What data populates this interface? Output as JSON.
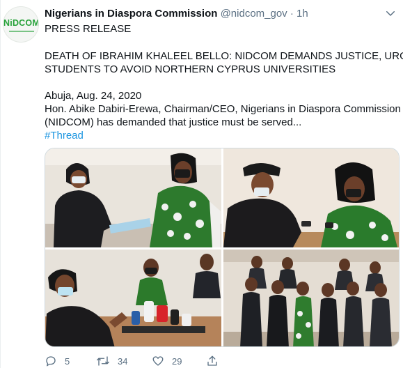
{
  "tweet": {
    "author": {
      "name": "Nigerians in Diaspora Commission",
      "handle": "@nidcom_gov",
      "avatar_text": "NiDCOM"
    },
    "separator": "·",
    "timestamp": "1h",
    "lines": [
      "PRESS RELEASE",
      "DEATH OF IBRAHIM KHALEEL BELLO: NIDCOM DEMANDS JUSTICE, URGES",
      "STUDENTS TO AVOID NORTHERN CYPRUS UNIVERSITIES",
      "Abuja, Aug. 24, 2020",
      "Hon. Abike Dabiri-Erewa, Chairman/CEO, Nigerians in Diaspora Commission",
      "(NIDCOM) has demanded that justice must be served..."
    ],
    "hashtag": "#Thread",
    "photos": [
      "photo-document-handover",
      "photo-phone-call",
      "photo-press-briefing",
      "photo-group"
    ],
    "actions": {
      "replies": "5",
      "retweets": "34",
      "likes": "29"
    },
    "icons": [
      "chevron-down-icon",
      "reply-icon",
      "retweet-icon",
      "like-icon",
      "share-icon"
    ],
    "colors": {
      "text": "#0f1419",
      "secondary": "#5b7083",
      "link": "#1b95e0",
      "border": "#ebeef0"
    }
  }
}
